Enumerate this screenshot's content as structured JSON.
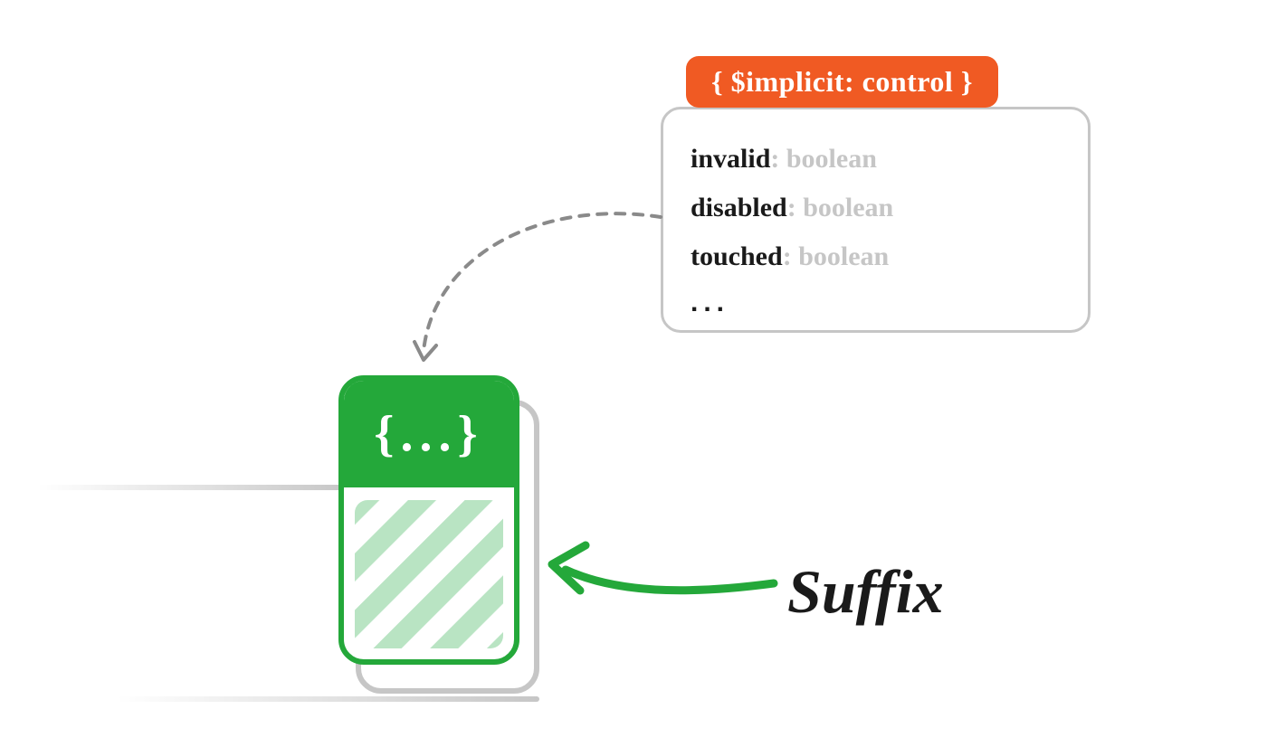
{
  "context": {
    "header_text": "{ $implicit: control }",
    "properties": [
      {
        "key": "invalid",
        "type": "boolean"
      },
      {
        "key": "disabled",
        "type": "boolean"
      },
      {
        "key": "touched",
        "type": "boolean"
      }
    ],
    "ellipsis": "..."
  },
  "capsule": {
    "header_glyph": "{...}"
  },
  "labels": {
    "suffix": "Suffix"
  },
  "colors": {
    "green": "#24a83a",
    "orange": "#f05a23",
    "gray": "#c6c6c6",
    "light_green": "#b9e4c3",
    "dark": "#1a1a1a"
  }
}
